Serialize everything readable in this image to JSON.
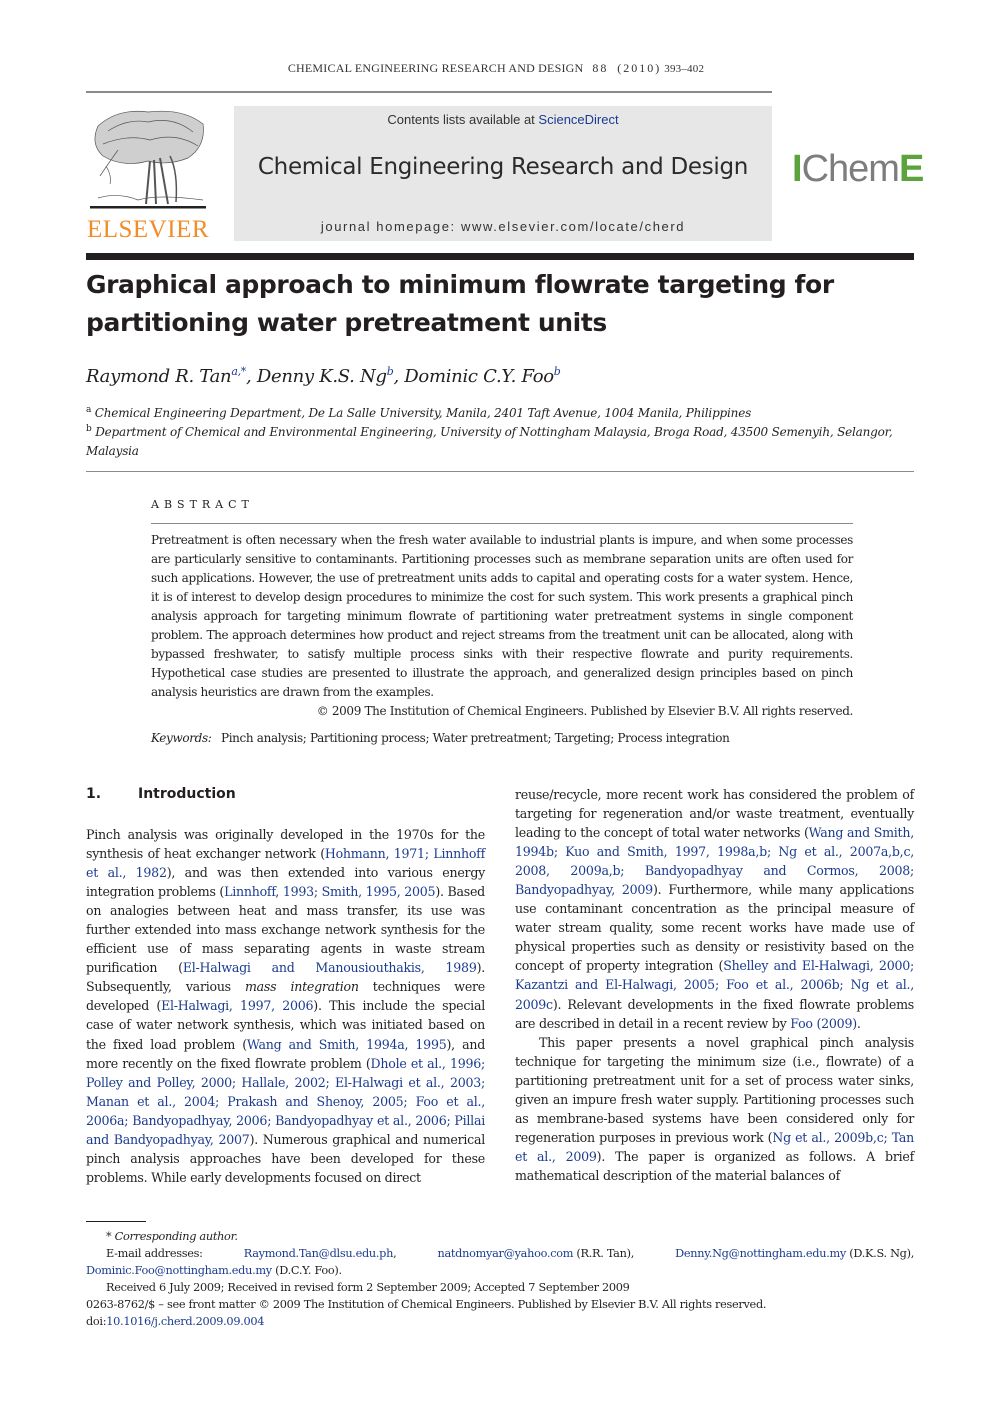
{
  "running_head": {
    "journal": "CHEMICAL ENGINEERING RESEARCH AND DESIGN",
    "volume": "88",
    "year": "(2010)",
    "pages": "393–402"
  },
  "masthead": {
    "contents_prefix": "Contents lists available at ",
    "contents_link": "ScienceDirect",
    "journal_title": "Chemical Engineering Research and Design",
    "homepage": "journal homepage: www.elsevier.com/locate/cherd",
    "publisher_logo": "ELSEVIER",
    "society_logo_prefix": "I",
    "society_logo_mid": "Chem",
    "society_logo_suffix": "E",
    "colors": {
      "elsevier_orange": "#f28c28",
      "icheme_green": "#5aa33d",
      "link_blue": "#1b3b8f",
      "masthead_bg": "#e7e7e8"
    }
  },
  "article": {
    "title": "Graphical approach to minimum flowrate targeting for partitioning water pretreatment units",
    "authors": [
      {
        "name": "Raymond R. Tan",
        "sup": "a,*",
        "sep": ", "
      },
      {
        "name": "Denny K.S. Ng",
        "sup": "b",
        "sep": ", "
      },
      {
        "name": "Dominic C.Y. Foo",
        "sup": "b",
        "sep": ""
      }
    ],
    "affiliations": [
      {
        "mark": "a",
        "text": "Chemical Engineering Department, De La Salle University, Manila, 2401 Taft Avenue, 1004 Manila, Philippines"
      },
      {
        "mark": "b",
        "text": "Department of Chemical and Environmental Engineering, University of Nottingham Malaysia, Broga Road, 43500 Semenyih, Selangor, Malaysia"
      }
    ]
  },
  "abstract": {
    "heading": "ABSTRACT",
    "body": "Pretreatment is often necessary when the fresh water available to industrial plants is impure, and when some processes are particularly sensitive to contaminants. Partitioning processes such as membrane separation units are often used for such applications. However, the use of pretreatment units adds to capital and operating costs for a water system. Hence, it is of interest to develop design procedures to minimize the cost for such system. This work presents a graphical pinch analysis approach for targeting minimum flowrate of partitioning water pretreatment systems in single component problem. The approach determines how product and reject streams from the treatment unit can be allocated, along with bypassed freshwater, to satisfy multiple process sinks with their respective flowrate and purity requirements. Hypothetical case studies are presented to illustrate the approach, and generalized design principles based on pinch analysis heuristics are drawn from the examples.",
    "copyright": "© 2009 The Institution of Chemical Engineers. Published by Elsevier B.V. All rights reserved.",
    "keywords_label": "Keywords:",
    "keywords": "Pinch analysis; Partitioning process; Water pretreatment; Targeting; Process integration"
  },
  "section1": {
    "number": "1.",
    "title": "Introduction",
    "left": [
      {
        "t": "Pinch analysis was originally developed in the 1970s for the synthesis of heat exchanger network ("
      },
      {
        "r": "Hohmann, 1971; Linnhoff et al., 1982"
      },
      {
        "t": "), and was then extended into various energy integration problems ("
      },
      {
        "r": "Linnhoff, 1993; Smith, 1995, 2005"
      },
      {
        "t": "). Based on analogies between heat and mass transfer, its use was further extended into mass exchange network synthesis for the efficient use of mass separating agents in waste stream purification ("
      },
      {
        "r": "El-Halwagi and Manousiouthakis, 1989"
      },
      {
        "t": "). Subsequently, various "
      },
      {
        "e": "mass integration"
      },
      {
        "t": " techniques were developed ("
      },
      {
        "r": "El-Halwagi, 1997, 2006"
      },
      {
        "t": "). This include the special case of water network synthesis, which was initiated based on the fixed load problem ("
      },
      {
        "r": "Wang and Smith, 1994a, 1995"
      },
      {
        "t": "), and more recently on the fixed flowrate problem ("
      },
      {
        "r": "Dhole et al., 1996; Polley and Polley, 2000; Hallale, 2002; El-Halwagi et al., 2003; Manan et al., 2004; Prakash and Shenoy, 2005; Foo et al., 2006a; Bandyopadhyay, 2006; Bandyopadhyay et al., 2006; Pillai and Bandyopadhyay, 2007"
      },
      {
        "t": "). Numerous graphical and numerical pinch analysis approaches have been developed for these problems. While early developments focused on direct"
      }
    ],
    "right_p1": [
      {
        "t": "reuse/recycle, more recent work has considered the problem of targeting for regeneration and/or waste treatment, eventually leading to the concept of total water networks ("
      },
      {
        "r": "Wang and Smith, 1994b; Kuo and Smith, 1997, 1998a,b; Ng et al., 2007a,b,c, 2008, 2009a,b; Bandyopadhyay and Cormos, 2008; Bandyopadhyay, 2009"
      },
      {
        "t": "). Furthermore, while many applications use contaminant concentration as the principal measure of water stream quality, some recent works have made use of physical properties such as density or resistivity based on the concept of property integration ("
      },
      {
        "r": "Shelley and El-Halwagi, 2000; Kazantzi and El-Halwagi, 2005; Foo et al., 2006b; Ng et al., 2009c"
      },
      {
        "t": "). Relevant developments in the fixed flowrate problems are described in detail in a recent review by "
      },
      {
        "r": "Foo (2009)"
      },
      {
        "t": "."
      }
    ],
    "right_p2": [
      {
        "t": "This paper presents a novel graphical pinch analysis technique for targeting the minimum size (i.e., flowrate) of a partitioning pretreatment unit for a set of process water sinks, given an impure fresh water supply. Partitioning processes such as membrane-based systems have been considered only for regeneration purposes in previous work ("
      },
      {
        "r": "Ng et al., 2009b,c; Tan et al., 2009"
      },
      {
        "t": "). The paper is organized as follows. A brief mathematical description of the material balances of"
      }
    ]
  },
  "footnotes": {
    "star": "*",
    "corresponding": "Corresponding author.",
    "email_label": "E-mail addresses:",
    "emails": [
      {
        "addr": "Raymond.Tan@dlsu.edu.ph",
        "after": ", "
      },
      {
        "addr": "natdnomyar@yahoo.com",
        "after": " (R.R. Tan), "
      },
      {
        "addr": "Denny.Ng@nottingham.edu.my",
        "after": " (D.K.S. Ng),"
      }
    ],
    "email_last": "Dominic.Foo@nottingham.edu.my",
    "email_last_after": " (D.C.Y. Foo).",
    "received": "Received 6 July 2009; Received in revised form 2 September 2009; Accepted 7 September 2009",
    "issn_line": "0263-8762/$ – see front matter © 2009 The Institution of Chemical Engineers. Published by Elsevier B.V. All rights reserved.",
    "doi_label": "doi:",
    "doi": "10.1016/j.cherd.2009.09.004"
  }
}
